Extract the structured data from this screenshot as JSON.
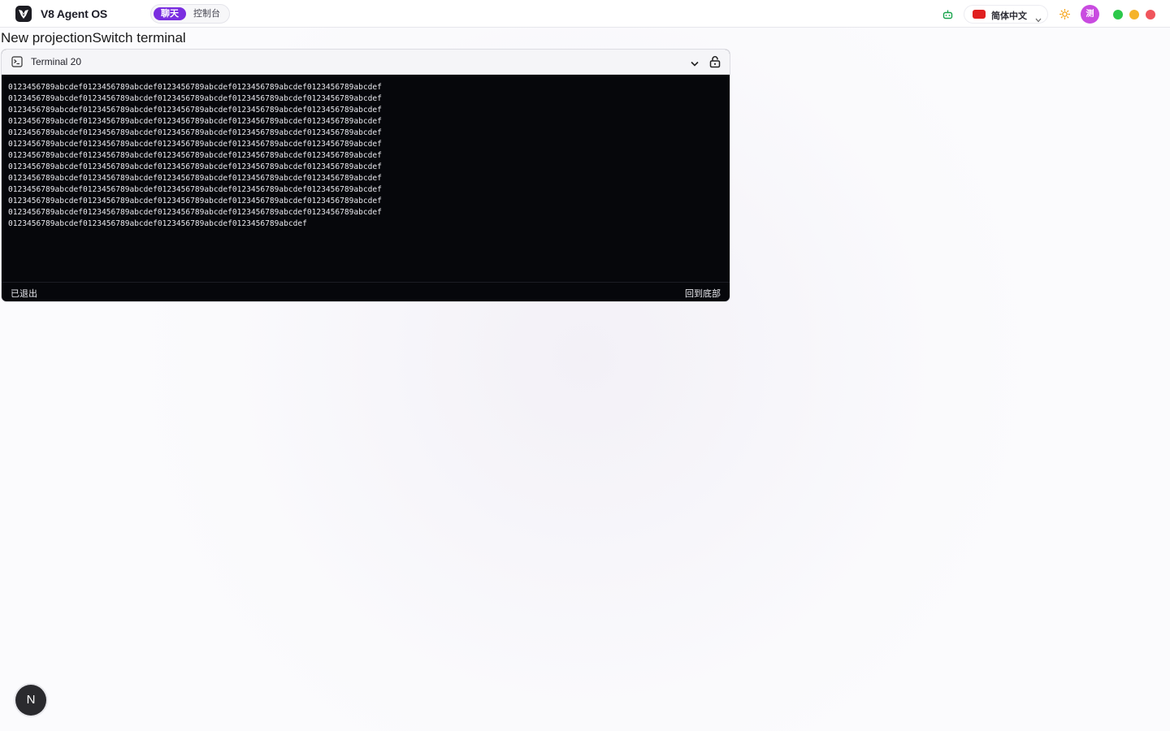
{
  "app": {
    "title": "V8 Agent OS",
    "accent_color": "#7a2ee0"
  },
  "mode_switch": {
    "chat_label": "聊天",
    "console_label": "控制台",
    "active": "chat"
  },
  "header_right": {
    "language_label": "简体中文",
    "avatar_text": "测",
    "icons": [
      "robot-icon",
      "sun-icon"
    ],
    "window_dots": [
      "#2cc84a",
      "#f5b32a",
      "#f0555c"
    ]
  },
  "page": {
    "heading": "New projectionSwitch terminal"
  },
  "terminal": {
    "title": "Terminal 20",
    "lines": [
      "0123456789abcdef0123456789abcdef0123456789abcdef0123456789abcdef0123456789abcdef",
      "0123456789abcdef0123456789abcdef0123456789abcdef0123456789abcdef0123456789abcdef",
      "0123456789abcdef0123456789abcdef0123456789abcdef0123456789abcdef0123456789abcdef",
      "0123456789abcdef0123456789abcdef0123456789abcdef0123456789abcdef0123456789abcdef",
      "0123456789abcdef0123456789abcdef0123456789abcdef0123456789abcdef0123456789abcdef",
      "0123456789abcdef0123456789abcdef0123456789abcdef0123456789abcdef0123456789abcdef",
      "0123456789abcdef0123456789abcdef0123456789abcdef0123456789abcdef0123456789abcdef",
      "0123456789abcdef0123456789abcdef0123456789abcdef0123456789abcdef0123456789abcdef",
      "0123456789abcdef0123456789abcdef0123456789abcdef0123456789abcdef0123456789abcdef",
      "0123456789abcdef0123456789abcdef0123456789abcdef0123456789abcdef0123456789abcdef",
      "0123456789abcdef0123456789abcdef0123456789abcdef0123456789abcdef0123456789abcdef",
      "0123456789abcdef0123456789abcdef0123456789abcdef0123456789abcdef0123456789abcdef",
      "0123456789abcdef0123456789abcdef0123456789abcdef0123456789abcdef"
    ],
    "status": "已退出",
    "scroll_to_bottom_label": "回到底部"
  },
  "floating_button": {
    "label": "N"
  }
}
